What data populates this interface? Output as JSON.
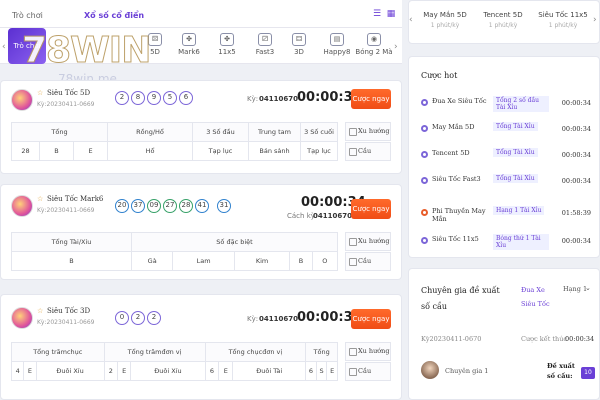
{
  "header": {
    "tab_trochoi": "Trò chơi",
    "tab_xoso": "Xổ số cổ điển",
    "logo": "78WIN",
    "logo_sub": "78win.me"
  },
  "game_tabs": [
    {
      "label": "Trò chơi",
      "icon": "grid-icon"
    },
    {
      "label": "5D",
      "icon": "dice-icon"
    },
    {
      "label": "3D",
      "icon": "dice-icon"
    },
    {
      "label": "Mark6",
      "icon": "clover-icon"
    },
    {
      "label": "11x5",
      "icon": "clover-icon"
    },
    {
      "label": "Fast3",
      "icon": "dice-icon"
    },
    {
      "label": "3D",
      "icon": "dice-icon"
    },
    {
      "label": "Happy8",
      "icon": "grid-icon"
    },
    {
      "label": "Bóng 2 Mà",
      "icon": "ball-icon"
    }
  ],
  "cards": [
    {
      "name": "Siêu Tốc 5D",
      "period": "Kỳ:20230411-0669",
      "balls": [
        "2",
        "8",
        "9",
        "5",
        "6"
      ],
      "ky_label": "Kỳ:",
      "ky_value": "04110670",
      "timer": "00:00:34",
      "bet": "Cược ngay",
      "headers": [
        "Tổng",
        "Rồng/Hổ",
        "3 Số đầu",
        "Trung tam",
        "3 Số cuối"
      ],
      "values": [
        "28",
        "B",
        "E",
        "Hổ",
        "Tạp lục",
        "Bán sảnh",
        "Tạp lục"
      ],
      "side1": "Xu hướng",
      "side2": "Cầu"
    },
    {
      "name": "Siêu Tốc Mark6",
      "period": "Kỳ:20230411-0669",
      "balls": [
        "20",
        "37",
        "09",
        "27",
        "28",
        "41",
        "31"
      ],
      "ky_label": "Cách kỳ:",
      "ky_value": "04110670",
      "timer": "00:00:34",
      "bet": "Cược ngay",
      "headers": [
        "Tổng Tài/Xỉu",
        "Số đặc biệt"
      ],
      "values": [
        "B",
        "Gà",
        "Lam",
        "Kim",
        "B",
        "O"
      ],
      "side1": "Xu hướng",
      "side2": "Cầu"
    },
    {
      "name": "Siêu Tốc 3D",
      "period": "Kỳ:20230411-0669",
      "balls": [
        "0",
        "2",
        "2"
      ],
      "ky_label": "Kỳ:",
      "ky_value": "04110670",
      "timer": "00:00:34",
      "bet": "Cược ngay",
      "headers": [
        "Tổng trămchục",
        "Tổng trămđơn vị",
        "Tổng chụcđơn vị",
        "Tổng"
      ],
      "values": [
        "4",
        "E",
        "Đuôi Xỉu",
        "2",
        "E",
        "Đuôi Xỉu",
        "6",
        "E",
        "Đuôi Tài",
        "6",
        "S",
        "E"
      ],
      "side1": "Xu hướng",
      "side2": "Cầu"
    }
  ],
  "right_top": [
    {
      "name": "May Mắn 5D",
      "sub": "1 phút/kỳ"
    },
    {
      "name": "Tencent 5D",
      "sub": "1 phút/kỳ"
    },
    {
      "name": "Siêu Tốc 11x5",
      "sub": "1 phút/kỳ"
    }
  ],
  "hot": {
    "title": "Cược hot",
    "rows": [
      {
        "name": "Đua Xe Siêu Tốc",
        "tag": "Tổng 2 số đầu Tài Xỉu",
        "time": "00:00:34"
      },
      {
        "name": "May Mắn 5D",
        "tag": "Tổng Tài Xỉu",
        "time": "00:00:34"
      },
      {
        "name": "Tencent 5D",
        "tag": "Tổng Tài Xỉu",
        "time": "00:00:34"
      },
      {
        "name": "Siêu Tốc Fast3",
        "tag": "Tổng Tài Xỉu",
        "time": "00:00:34"
      },
      {
        "name": "Phi Thuyền May Mắn",
        "tag": "Hạng 1 Tài Xỉu",
        "time": "01:58:39"
      },
      {
        "name": "Siêu Tốc 11x5",
        "tag": "Bóng thứ 1 Tài Xỉu",
        "time": "00:00:34"
      }
    ]
  },
  "expert": {
    "title": "Chuyên gia đề xuất số cầu",
    "game": "Đua Xe Siêu Tốc",
    "rank": "Hạng 1",
    "period": "Kỳ20230411-0670",
    "result_label": "Cược kết thúc",
    "result_time": "00:00:34",
    "expert_name": "Chuyên gia 1",
    "suggest_label": "Đề xuất số cầu:",
    "suggest_value": "10"
  }
}
